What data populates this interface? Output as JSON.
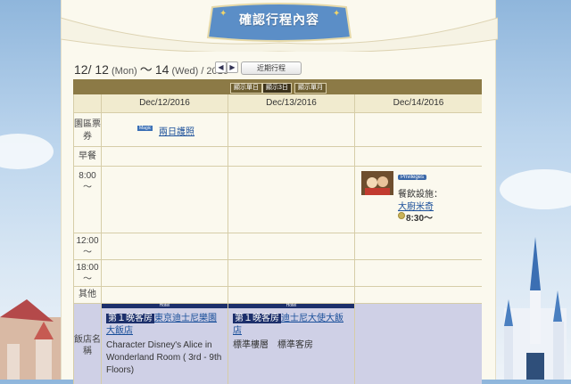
{
  "header": {
    "title": "確認行程內容"
  },
  "date_range": {
    "start_day": "12/ 12",
    "start_weekday": "(Mon)",
    "separator": "～",
    "end_day": "14",
    "end_weekday": "(Wed)",
    "year": "/ 2016"
  },
  "nav": {
    "prev": "◀",
    "next": "▶",
    "recent_label": "近期行程"
  },
  "view_buttons": [
    "顯示單日",
    "顯示3日",
    "顯示單月"
  ],
  "columns": [
    "Dec/12/2016",
    "Dec/13/2016",
    "Dec/14/2016"
  ],
  "rows": {
    "ticket": {
      "label": "園區票券",
      "item": "兩日護照",
      "icon_text": "Magic"
    },
    "breakfast": {
      "label": "早餐"
    },
    "t800": {
      "label": "8:00\n～"
    },
    "t1200": {
      "label": "12:00\n～"
    },
    "t1800": {
      "label": "18:00\n～"
    },
    "other": {
      "label": "其他"
    },
    "hotel": {
      "label": "飯店名稱"
    }
  },
  "dining": {
    "badge": "Privileges",
    "category": "餐飲設施：",
    "name": "大廚米奇",
    "time": "8:30～"
  },
  "hotels": [
    {
      "bar": "Hotel",
      "tag": "第１晚客房",
      "name": "東京迪士尼樂園大飯店",
      "room": "Character Disney's Alice in Wonderland Room ( 3rd - 9th Floors)"
    },
    {
      "bar": "Hotel",
      "tag": "第１晚客房",
      "name": "迪士尼大使大飯店",
      "room": "標準樓層　標準客房"
    }
  ],
  "colors": {
    "header_bar": "#8c7a46",
    "hotel_row": "#cfd0e6",
    "link": "#1a4f9a",
    "hotel_bar": "#1c2f6b"
  }
}
